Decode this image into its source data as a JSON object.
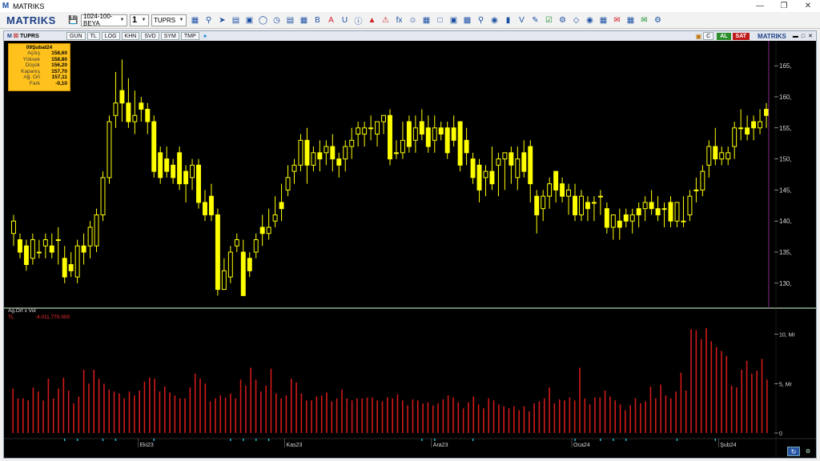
{
  "window": {
    "title": "MATRIKS",
    "icon": "M"
  },
  "toolbar": {
    "brand": "MATRIKS",
    "layout_select": "1024-100-BEYA",
    "page_select": "1",
    "symbol_select": "TUPRS",
    "icons": [
      "save-icon",
      "zoom-icon",
      "cursor-icon",
      "chart-type-icon",
      "monitor-icon",
      "circle-icon",
      "clock-icon",
      "news-icon",
      "table-icon",
      "bold-icon",
      "text-icon",
      "underline-icon",
      "info-icon",
      "chart-icon",
      "alert-icon",
      "formula-icon",
      "users-icon",
      "calendar-icon",
      "window-icon",
      "book-icon",
      "copy-icon",
      "search-icon",
      "money-icon",
      "order-icon",
      "volume-icon",
      "edit-icon",
      "check-icon",
      "settings-icon",
      "network-icon",
      "eye-icon",
      "image-icon",
      "mail-icon",
      "calc-icon",
      "chat-icon",
      "gear-icon"
    ]
  },
  "chart_window": {
    "symbol": "TUPRS",
    "tabs": [
      "GUN",
      "TL",
      "LOG",
      "KHN",
      "SVD",
      "SYM",
      "TMP"
    ],
    "buy_label": "AL",
    "sell_label": "SAT",
    "brand": "MATRIKS",
    "c_label": "C"
  },
  "infobox": {
    "date": "09Şubat24",
    "rows": [
      {
        "k": "Açılış",
        "v": "158,60"
      },
      {
        "k": "Yüksek",
        "v": "158,80"
      },
      {
        "k": "Düşük",
        "v": "156,20"
      },
      {
        "k": "Kapanış",
        "v": "157,70"
      },
      {
        "k": "Ağ. Ort",
        "v": "157,11"
      },
      {
        "k": "Fark",
        "v": "-0,10"
      }
    ]
  },
  "volume_panel": {
    "label": "Ag.Ort x Vol",
    "currency": "TL",
    "value": ":4.011.770.000"
  },
  "colors": {
    "background": "#000000",
    "candle": "#ffff00",
    "volume": "#d21a1a",
    "axis_text": "#d8d8d8",
    "separator": "#8fb08f",
    "cursor_line": "#8a2a8a",
    "tick": "#22b8c8"
  },
  "chart_data": [
    {
      "type": "candlestick",
      "title": "",
      "y_axis_labels": [
        "165,",
        "160,",
        "155,",
        "150,",
        "145,",
        "140,",
        "135,",
        "130,"
      ],
      "y_ticks": [
        165,
        160,
        155,
        150,
        145,
        140,
        135,
        130
      ],
      "ylim": [
        126.5,
        168.5
      ],
      "x_labels": [
        {
          "label": "Eki23",
          "index": 20
        },
        {
          "label": "Kas23",
          "index": 43
        },
        {
          "label": "Ara23",
          "index": 66
        },
        {
          "label": "Oca24",
          "index": 88
        },
        {
          "label": "Şub24",
          "index": 111
        }
      ],
      "ohlc": [
        [
          138,
          141,
          136,
          140
        ],
        [
          137,
          138,
          134,
          135
        ],
        [
          136,
          137,
          132,
          133
        ],
        [
          134,
          138,
          133,
          137
        ],
        [
          135,
          137,
          134,
          135
        ],
        [
          136,
          138,
          134,
          137
        ],
        [
          136,
          138,
          134,
          135
        ],
        [
          137,
          139,
          133,
          137
        ],
        [
          134,
          136,
          130,
          131
        ],
        [
          133,
          135,
          131,
          132
        ],
        [
          131,
          137,
          130,
          136
        ],
        [
          136,
          138,
          133,
          135
        ],
        [
          136,
          140,
          134,
          139
        ],
        [
          136,
          142,
          135,
          141
        ],
        [
          141,
          148,
          140,
          147
        ],
        [
          147,
          157,
          146,
          156
        ],
        [
          157,
          164,
          155,
          159
        ],
        [
          161,
          166,
          156,
          159
        ],
        [
          159,
          163,
          155,
          156
        ],
        [
          156,
          161,
          154,
          157
        ],
        [
          159,
          160,
          156,
          158
        ],
        [
          158,
          159,
          154,
          156
        ],
        [
          156,
          157,
          147,
          148
        ],
        [
          151,
          152,
          146,
          147
        ],
        [
          150,
          152,
          147,
          148
        ],
        [
          149,
          150,
          146,
          147
        ],
        [
          151,
          152,
          145,
          146
        ],
        [
          148,
          149,
          143,
          146
        ],
        [
          147,
          150,
          145,
          149
        ],
        [
          149,
          150,
          142,
          143
        ],
        [
          143,
          145,
          140,
          141
        ],
        [
          144,
          146,
          140,
          141
        ],
        [
          141,
          142,
          128,
          129
        ],
        [
          129,
          134,
          129,
          132
        ],
        [
          131,
          136,
          130,
          135
        ],
        [
          136,
          138,
          135,
          137
        ],
        [
          135,
          137,
          128,
          128
        ],
        [
          134,
          135,
          131,
          132
        ],
        [
          135,
          138,
          134,
          137
        ],
        [
          139,
          141,
          136,
          138
        ],
        [
          138,
          142,
          137,
          139
        ],
        [
          140,
          144,
          139,
          141
        ],
        [
          143,
          146,
          140,
          142
        ],
        [
          145,
          149,
          144,
          147
        ],
        [
          148,
          150,
          146,
          149
        ],
        [
          149,
          154,
          148,
          153
        ],
        [
          153,
          155,
          146,
          149
        ],
        [
          149,
          152,
          148,
          151
        ],
        [
          151,
          153,
          148,
          150
        ],
        [
          151,
          153,
          149,
          152
        ],
        [
          152,
          154,
          148,
          150
        ],
        [
          150,
          151,
          147,
          149
        ],
        [
          150,
          153,
          148,
          152
        ],
        [
          152,
          155,
          150,
          153
        ],
        [
          154,
          156,
          152,
          155
        ],
        [
          154,
          156,
          152,
          155
        ],
        [
          155,
          157,
          153,
          155
        ],
        [
          154,
          155,
          152,
          156
        ],
        [
          156,
          157,
          154,
          157
        ],
        [
          157,
          158,
          149,
          150
        ],
        [
          151,
          153,
          150,
          151
        ],
        [
          151,
          156,
          150,
          153
        ],
        [
          156,
          157,
          151,
          152
        ],
        [
          153,
          157,
          151,
          155
        ],
        [
          156,
          158,
          153,
          154
        ],
        [
          155,
          157,
          151,
          152
        ],
        [
          153,
          157,
          151,
          155
        ],
        [
          155,
          156,
          153,
          154
        ],
        [
          155,
          156,
          150,
          151
        ],
        [
          155,
          157,
          152,
          153
        ],
        [
          156,
          156,
          148,
          149
        ],
        [
          153,
          155,
          149,
          151
        ],
        [
          150,
          151,
          146,
          147
        ],
        [
          149,
          150,
          143,
          145
        ],
        [
          147,
          149,
          144,
          148
        ],
        [
          148,
          152,
          145,
          146
        ],
        [
          149,
          151,
          144,
          150
        ],
        [
          150,
          151,
          145,
          151
        ],
        [
          151,
          152,
          146,
          149
        ],
        [
          147,
          152,
          145,
          150
        ],
        [
          151,
          153,
          147,
          148
        ],
        [
          152,
          153,
          143,
          146
        ],
        [
          144,
          145,
          138,
          141
        ],
        [
          142,
          145,
          140,
          144
        ],
        [
          144,
          147,
          142,
          146
        ],
        [
          148,
          148,
          143,
          145
        ],
        [
          146,
          147,
          143,
          144
        ],
        [
          144,
          146,
          141,
          145
        ],
        [
          144,
          146,
          140,
          141
        ],
        [
          141,
          145,
          140,
          144
        ],
        [
          143,
          144,
          140,
          142
        ],
        [
          143,
          144,
          140,
          143
        ],
        [
          144,
          145,
          141,
          144
        ],
        [
          142,
          143,
          138,
          139
        ],
        [
          139,
          141,
          137,
          141
        ],
        [
          140,
          142,
          137,
          139
        ],
        [
          141,
          142,
          139,
          140
        ],
        [
          140,
          142,
          138,
          141
        ],
        [
          142,
          143,
          139,
          141
        ],
        [
          142,
          144,
          140,
          143
        ],
        [
          143,
          145,
          141,
          142
        ],
        [
          142,
          144,
          140,
          141
        ],
        [
          142,
          143,
          139,
          142
        ],
        [
          143,
          144,
          139,
          140
        ],
        [
          140,
          143,
          139,
          143
        ],
        [
          140,
          144,
          139,
          140
        ],
        [
          141,
          145,
          140,
          144
        ],
        [
          145,
          147,
          143,
          145
        ],
        [
          145,
          149,
          144,
          148
        ],
        [
          149,
          153,
          147,
          152
        ],
        [
          152,
          155,
          149,
          150
        ],
        [
          150,
          152,
          149,
          151
        ],
        [
          150,
          152,
          149,
          151
        ],
        [
          152,
          156,
          150,
          155
        ],
        [
          155,
          158,
          153,
          155
        ],
        [
          155,
          157,
          153,
          154
        ],
        [
          156,
          157,
          153,
          155
        ],
        [
          155,
          158,
          154,
          156
        ],
        [
          158,
          159,
          155,
          157
        ]
      ]
    },
    {
      "type": "bar",
      "title": "",
      "y_axis_labels": [
        "10, Mr",
        "5, Mr",
        "0"
      ],
      "y_ticks": [
        10,
        5,
        0
      ],
      "ylim": [
        0,
        11.5
      ],
      "values": [
        4.5,
        3.5,
        3.5,
        3.3,
        4.6,
        4.2,
        3.3,
        5.5,
        3.5,
        4.5,
        5.6,
        4.3,
        3.0,
        3.7,
        6.4,
        5.0,
        6.4,
        5.5,
        5.0,
        4.4,
        4.2,
        4.0,
        3.5,
        4.2,
        3.8,
        4.3,
        5.2,
        5.6,
        5.5,
        4.2,
        4.7,
        4.1,
        3.8,
        3.5,
        3.5,
        4.6,
        6.0,
        5.5,
        5.0,
        3.2,
        3.5,
        3.8,
        3.6,
        4.0,
        3.5,
        5.4,
        4.8,
        6.6,
        5.4,
        4.2,
        4.8,
        6.5,
        4.0,
        3.5,
        3.8,
        5.5,
        5.1,
        4.0,
        3.3,
        3.3,
        3.7,
        3.8,
        4.1,
        3.2,
        3.5,
        4.4,
        3.5,
        3.3,
        3.5,
        3.5,
        3.6,
        3.6,
        3.3,
        3.2,
        3.6,
        3.5,
        3.9,
        3.3,
        2.8,
        3.4,
        3.3,
        3.0,
        3.1,
        2.8,
        3.0,
        3.4,
        3.8,
        3.6,
        3.1,
        2.5,
        3.1,
        3.7,
        2.9,
        2.5,
        3.5,
        3.3,
        2.9,
        2.7,
        2.5,
        2.7,
        2.3,
        2.7,
        2.2,
        3.0,
        3.2,
        3.5,
        4.6,
        3.0,
        3.4,
        3.3,
        3.6,
        3.3,
        6.6,
        3.5,
        2.9,
        3.6,
        3.6,
        4.3,
        3.7,
        3.3,
        2.9,
        2.3,
        2.8,
        3.5,
        3.0,
        3.2,
        4.7,
        3.5,
        4.9,
        3.8,
        3.5,
        4.2,
        6.1,
        4.3,
        10.5,
        10.4,
        9.5,
        10.6,
        9.3,
        8.7,
        8.3,
        7.8,
        4.8,
        4.6,
        6.4,
        7.3,
        6.0,
        6.3,
        7.5,
        5.4
      ]
    }
  ]
}
